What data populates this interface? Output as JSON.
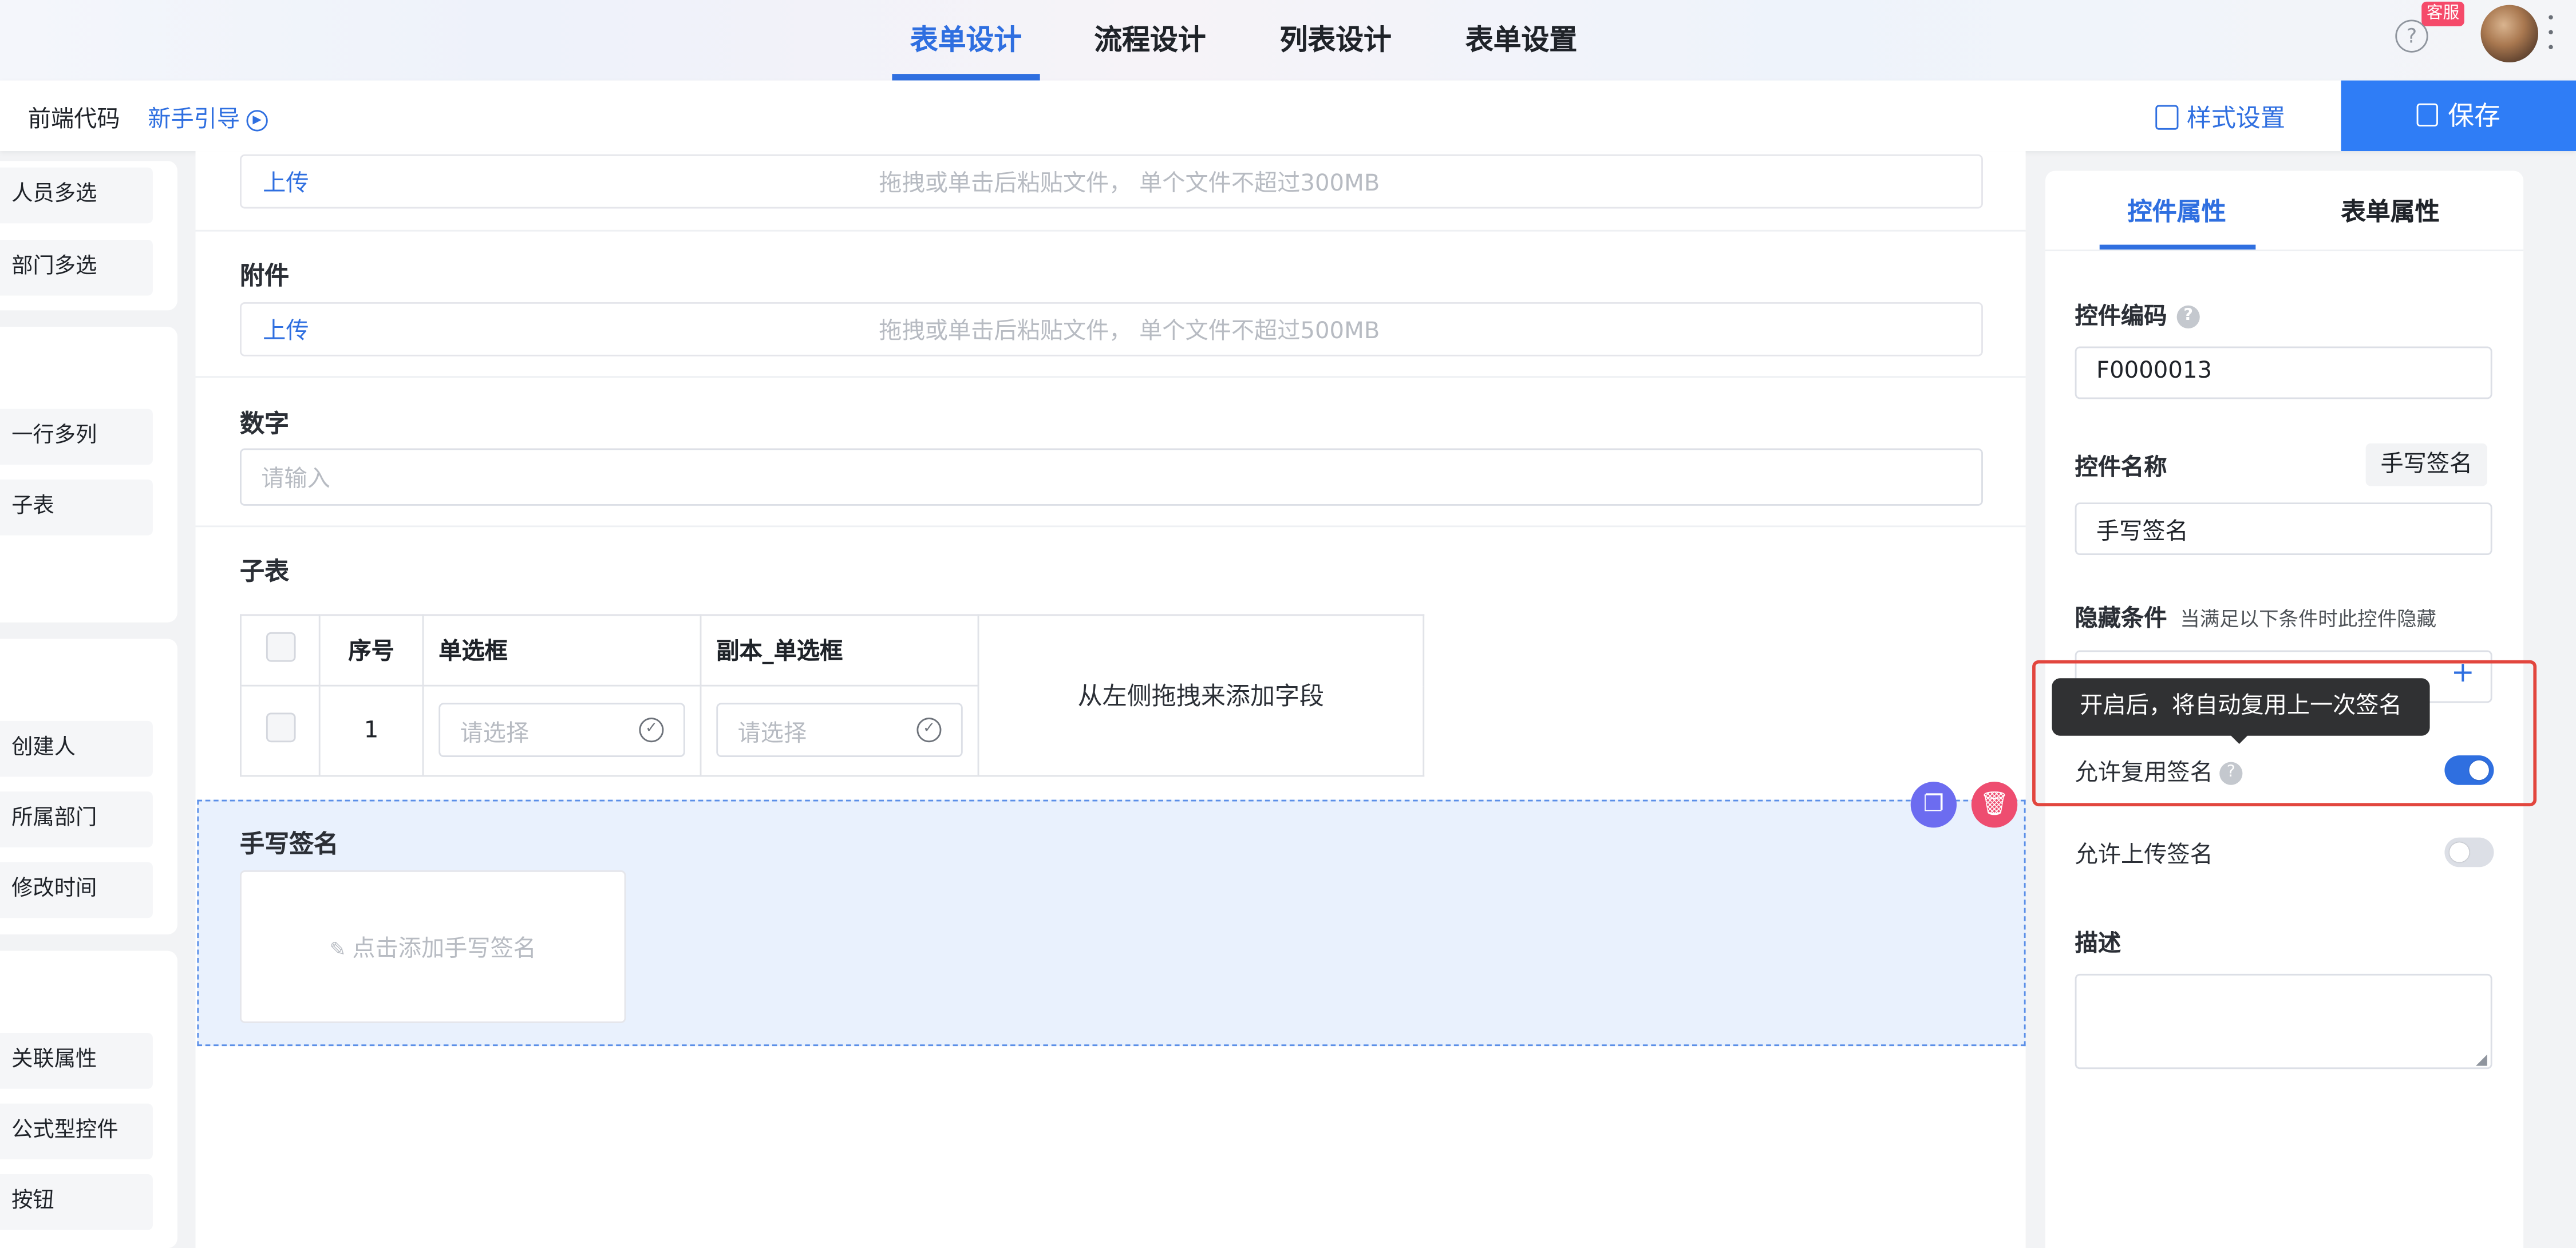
{
  "nav": {
    "tabs": [
      {
        "label": "表单设计"
      },
      {
        "label": "流程设计"
      },
      {
        "label": "列表设计"
      },
      {
        "label": "表单设置"
      }
    ],
    "help_icon": "?",
    "service_badge": "客服"
  },
  "toolbar": {
    "frontend_code": "前端代码",
    "guide": "新手引导",
    "style_settings": "样式设置",
    "save": "保存"
  },
  "palette": {
    "group1": [
      "人员多选",
      "部门多选"
    ],
    "group2": [
      "一行多列",
      "子表"
    ],
    "group3": [
      "创建人",
      "所属部门",
      "修改时间"
    ],
    "group4": [
      "关联属性",
      "公式型控件",
      "按钮"
    ]
  },
  "canvas": {
    "upload1": {
      "link": "上传",
      "hint": "拖拽或单击后粘贴文件， 单个文件不超过300MB"
    },
    "attachment": {
      "label": "附件",
      "link": "上传",
      "hint": "拖拽或单击后粘贴文件， 单个文件不超过500MB"
    },
    "number": {
      "label": "数字",
      "placeholder": "请输入"
    },
    "subtable": {
      "label": "子表",
      "headers": [
        "序号",
        "单选框",
        "副本_单选框"
      ],
      "row_index": "1",
      "select_placeholder": "请选择",
      "drop_hint": "从左侧拖拽来添加字段"
    },
    "signature": {
      "label": "手写签名",
      "placeholder": "点击添加手写签名"
    }
  },
  "props": {
    "tabs": [
      "控件属性",
      "表单属性"
    ],
    "code_label": "控件编码",
    "code_value": "F0000013",
    "name_label": "控件名称",
    "name_tag": "手写签名",
    "name_value": "手写签名",
    "hidden_label": "隐藏条件",
    "hidden_hint": "当满足以下条件时此控件隐藏",
    "tooltip": "开启后，将自动复用上一次签名",
    "reuse_label": "允许复用签名",
    "reuse_on": true,
    "upload_label": "允许上传签名",
    "upload_on": false,
    "desc_label": "描述",
    "accent_color": "#2f6fe0",
    "highlight_color": "#e2463e"
  }
}
